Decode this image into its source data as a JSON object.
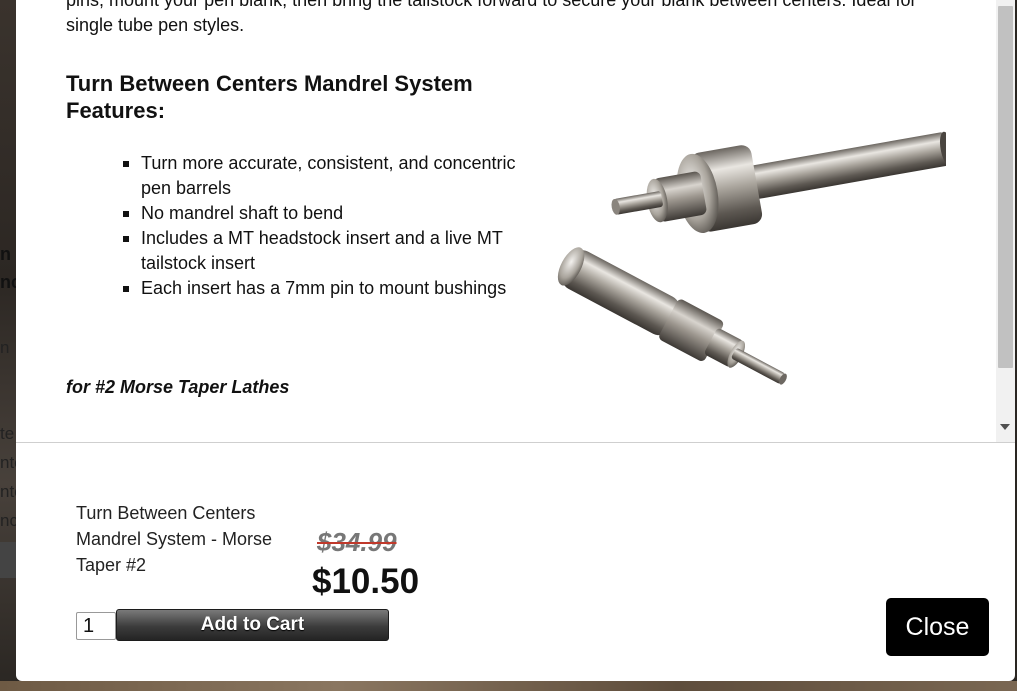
{
  "modal": {
    "description": {
      "intro": "pins, mount your pen blank, then bring the tailstock forward to secure your blank between centers. Ideal for single tube pen styles.",
      "features_heading": "Turn Between Centers Mandrel System Features:",
      "features": [
        "Turn more accurate, consistent, and concentric pen barrels",
        "No mandrel shaft to bend",
        "Includes a MT headstock insert and a live MT tailstock insert",
        "Each insert has a 7mm pin to mount bushings"
      ],
      "taper_note": "for #2 Morse Taper Lathes"
    },
    "product": {
      "name": "Turn Between Centers Mandrel System - Morse Taper #2",
      "original_price": "$34.99",
      "sale_price": "$10.50"
    },
    "cart": {
      "quantity": "1",
      "add_to_cart_label": "Add to Cart"
    },
    "close_label": "Close"
  },
  "backdrop": {
    "fragments": [
      "n",
      "nc",
      "n",
      "te",
      "nte",
      "nte",
      "nc"
    ]
  },
  "colors": {
    "modal_bg": "#ffffff",
    "button_dark": "#000000",
    "strike_red": "#c0392b",
    "old_price_gray": "#777777"
  },
  "icons": [
    "scroll-down-arrow-icon"
  ]
}
